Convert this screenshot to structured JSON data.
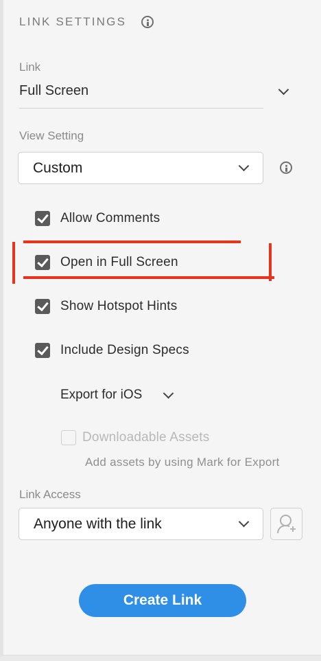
{
  "panel": {
    "title": "LINK SETTINGS"
  },
  "link": {
    "label": "Link",
    "value": "Full Screen"
  },
  "view_setting": {
    "label": "View Setting",
    "value": "Custom"
  },
  "options": [
    {
      "label": "Allow Comments",
      "checked": true
    },
    {
      "label": "Open in Full Screen",
      "checked": true
    },
    {
      "label": "Show Hotspot Hints",
      "checked": true
    },
    {
      "label": "Include Design Specs",
      "checked": true
    }
  ],
  "export": {
    "label": "Export for iOS",
    "downloadable_label": "Downloadable Assets",
    "downloadable_checked": false,
    "hint": "Add assets by using Mark for Export"
  },
  "link_access": {
    "label": "Link Access",
    "value": "Anyone with the link"
  },
  "actions": {
    "create_label": "Create Link"
  },
  "colors": {
    "accent": "#2f8ee6",
    "highlight": "#e8321c",
    "checkbox": "#5a5a5a"
  },
  "icons": [
    "info-icon",
    "chevron-down-icon",
    "checkmark-icon",
    "add-user-icon"
  ]
}
